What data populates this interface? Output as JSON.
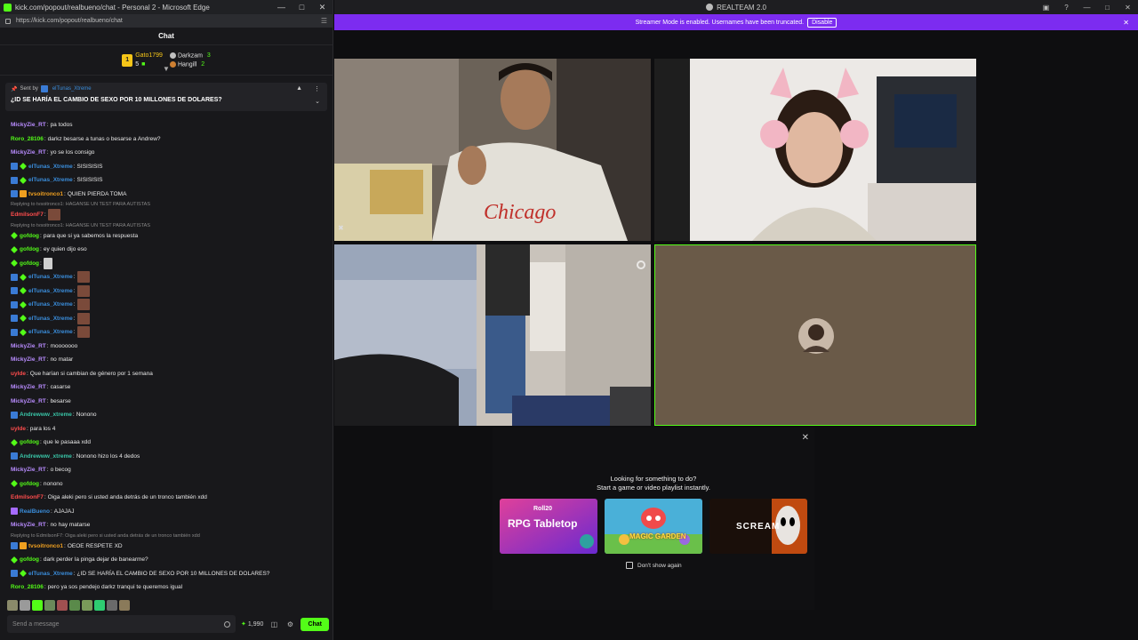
{
  "browser": {
    "window_title": "kick.com/popout/realbueno/chat - Personal 2 - Microsoft Edge",
    "url": "https://kick.com/popout/realbueno/chat"
  },
  "chat": {
    "header": "Chat",
    "leaderboard": {
      "first": {
        "name": "Gato1799",
        "count": "5"
      },
      "second": {
        "name": "Darkzam",
        "count": "3"
      },
      "third": {
        "name": "Hangill",
        "count": "2"
      }
    },
    "pinned": {
      "sent_by_label": "Sent by",
      "sender": "elTunas_Xtreme",
      "message": "¿ID SE HARÍA EL CAMBIO DE SEXO POR 10 MILLONES DE DOLARES?"
    },
    "messages": [
      {
        "user": "MickyZie_RT",
        "color": "#b98cff",
        "badges": [],
        "text": "pa todos"
      },
      {
        "user": "Roro_28106",
        "color": "#53fc18",
        "badges": [],
        "text": "darkz besarse a tunas o besarse a Andrew?"
      },
      {
        "user": "MickyZie_RT",
        "color": "#b98cff",
        "badges": [],
        "text": "yo se los consigo"
      },
      {
        "user": "elTunas_Xtreme",
        "color": "#3a8ddb",
        "badges": [
          "box",
          "vip"
        ],
        "text": "SISISISIS"
      },
      {
        "user": "elTunas_Xtreme",
        "color": "#3a8ddb",
        "badges": [
          "box",
          "vip"
        ],
        "text": "SISISISIS"
      },
      {
        "user": "tvsoitronco1",
        "color": "#f0a020",
        "badges": [
          "box",
          "og"
        ],
        "text": "QUIEN PIERDA TOMA"
      },
      {
        "reply": "Replying to tvsoitronco1: HAGANSE UN TEST PARA AUTISTAS"
      },
      {
        "user": "EdmilsonF7",
        "color": "#ff4d4d",
        "badges": [],
        "text": "",
        "emote": true
      },
      {
        "reply": "Replying to tvsoitronco1: HAGANSE UN TEST PARA AUTISTAS"
      },
      {
        "user": "gofdog",
        "color": "#53fc18",
        "badges": [
          "vip"
        ],
        "text": "para que si ya sabemos la respuesta"
      },
      {
        "user": "gofdog",
        "color": "#53fc18",
        "badges": [
          "vip"
        ],
        "text": "ey quien dijo eso"
      },
      {
        "user": "gofdog",
        "color": "#53fc18",
        "badges": [
          "vip"
        ],
        "text": "",
        "emote": "small"
      },
      {
        "user": "elTunas_Xtreme",
        "color": "#3a8ddb",
        "badges": [
          "box",
          "vip"
        ],
        "text": "",
        "emote": true
      },
      {
        "user": "elTunas_Xtreme",
        "color": "#3a8ddb",
        "badges": [
          "box",
          "vip"
        ],
        "text": "",
        "emote": true
      },
      {
        "user": "elTunas_Xtreme",
        "color": "#3a8ddb",
        "badges": [
          "box",
          "vip"
        ],
        "text": "",
        "emote": true
      },
      {
        "user": "elTunas_Xtreme",
        "color": "#3a8ddb",
        "badges": [
          "box",
          "vip"
        ],
        "text": "",
        "emote": true
      },
      {
        "user": "elTunas_Xtreme",
        "color": "#3a8ddb",
        "badges": [
          "box",
          "vip"
        ],
        "text": "",
        "emote": true
      },
      {
        "user": "MickyZie_RT",
        "color": "#b98cff",
        "badges": [],
        "text": "mooooooo"
      },
      {
        "user": "MickyZie_RT",
        "color": "#b98cff",
        "badges": [],
        "text": "no matar"
      },
      {
        "user": "uylde",
        "color": "#ff4d4d",
        "badges": [],
        "text": "Que harían si cambian de género por 1 semana"
      },
      {
        "user": "MickyZie_RT",
        "color": "#b98cff",
        "badges": [],
        "text": "casarse"
      },
      {
        "user": "MickyZie_RT",
        "color": "#b98cff",
        "badges": [],
        "text": "besarse"
      },
      {
        "user": "Andrewww_xtreme",
        "color": "#39c6a8",
        "badges": [
          "box"
        ],
        "text": "Nonono"
      },
      {
        "user": "uylde",
        "color": "#ff4d4d",
        "badges": [],
        "text": "para los 4"
      },
      {
        "user": "gofdog",
        "color": "#53fc18",
        "badges": [
          "vip"
        ],
        "text": "que le pasaaa xdd"
      },
      {
        "user": "Andrewww_xtreme",
        "color": "#39c6a8",
        "badges": [
          "box"
        ],
        "text": "Nonono hizo los 4 dedos"
      },
      {
        "user": "MickyZie_RT",
        "color": "#b98cff",
        "badges": [],
        "text": "o becog"
      },
      {
        "user": "gofdog",
        "color": "#53fc18",
        "badges": [
          "vip"
        ],
        "text": "nonono"
      },
      {
        "user": "EdmilsonF7",
        "color": "#ff4d4d",
        "badges": [],
        "text": "Oiga aleki pero si usted anda detrás de un tronco también xdd"
      },
      {
        "user": "RealBueno",
        "color": "#3a8ddb",
        "badges": [
          "mod"
        ],
        "text": "AJAJAJ"
      },
      {
        "user": "MickyZie_RT",
        "color": "#b98cff",
        "badges": [],
        "text": "no hay matarse"
      },
      {
        "reply": "Replying to EdmilsonF7: Oiga aleki pero si usted anda detrás de un tronco también xdd"
      },
      {
        "user": "tvsoitronco1",
        "color": "#f0a020",
        "badges": [
          "box",
          "og"
        ],
        "text": "OEOE RESPETE XD"
      },
      {
        "user": "gofdog",
        "color": "#53fc18",
        "badges": [
          "vip"
        ],
        "text": "dark perder la pinga dejar de banearme?"
      },
      {
        "user": "elTunas_Xtreme",
        "color": "#3a8ddb",
        "badges": [
          "box",
          "vip"
        ],
        "text": "¿ID SE HARÍA EL CAMBIO DE SEXO POR 10 MILLONES DE DOLARES?"
      },
      {
        "user": "Roro_28106",
        "color": "#53fc18",
        "badges": [],
        "text": "pero ya sos pendejo darkz tranqui te queremos igual"
      }
    ],
    "input_placeholder": "Send a message",
    "points": "1,990",
    "send_label": "Chat"
  },
  "app": {
    "title": "REALTEAM 2.0",
    "banner_text": "Streamer Mode is enabled. Usernames have been truncated.",
    "banner_button": "Disable",
    "overlay": {
      "line1": "Looking for something to do?",
      "line2": "Start a game or video playlist instantly.",
      "cards": [
        {
          "name": "RPG Tabletop",
          "brand": "Roll20"
        },
        {
          "name": "MAGIC GARDEN"
        },
        {
          "name": "SCREAM"
        }
      ],
      "dont_show": "Don't show again"
    }
  },
  "colors": {
    "kick_green": "#53fc18",
    "banner_purple": "#7c2cf0",
    "empty_tile": "#6a5a48"
  }
}
